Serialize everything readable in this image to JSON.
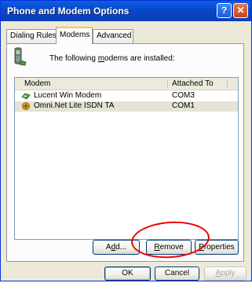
{
  "window": {
    "title": "Phone and Modem Options"
  },
  "titlebar": {
    "help_glyph": "?",
    "close_glyph": "✕"
  },
  "tabs": [
    {
      "label": "Dialing Rules"
    },
    {
      "label": "Modems"
    },
    {
      "label": "Advanced"
    }
  ],
  "intro": {
    "before": "The following ",
    "mnemonic": "m",
    "after": "odems are  installed:"
  },
  "list": {
    "columns": [
      "Modem",
      "Attached To"
    ],
    "rows": [
      {
        "name": "Lucent Win Modem",
        "port": "COM3",
        "selected": false,
        "icon": "modem-icon"
      },
      {
        "name": "Omni.Net Lite ISDN TA",
        "port": "COM1",
        "selected": true,
        "icon": "isdn-icon"
      }
    ]
  },
  "buttons": {
    "add": {
      "mnemonic": "d",
      "pre": "A",
      "post": "d..."
    },
    "remove": {
      "mnemonic": "R",
      "post": "emove"
    },
    "properties": {
      "mnemonic": "P",
      "post": "roperties"
    },
    "ok": "OK",
    "cancel": "Cancel",
    "apply": {
      "mnemonic": "A",
      "post": "pply"
    }
  },
  "colors": {
    "title_bar": "#0846c4",
    "annotation_circle": "#e00000",
    "selected_row": "#e5e3d6"
  }
}
